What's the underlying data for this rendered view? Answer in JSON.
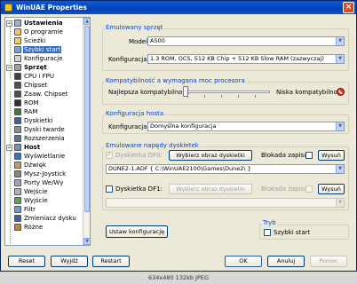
{
  "window": {
    "title": "WinUAE Properties",
    "close_label": "×"
  },
  "tree": {
    "group_ustawienia": "Ustawienia",
    "o_programie": "O programie",
    "sciezki": "Ścieżki",
    "szybki_start": "Szybki start",
    "konfiguracje": "Konfiguracje",
    "group_sprzet": "Sprzęt",
    "cpu": "CPU i FPU",
    "chipset": "Chipset",
    "zaaw_chipset": "Zaaw. Chipset",
    "rom": "ROM",
    "ram": "RAM",
    "dyskietki": "Dyskietki",
    "dyski_twarde": "Dyski twarde",
    "rozszerzenia": "Rozszerzenia",
    "group_host": "Host",
    "wyswietlanie": "Wyświetlanie",
    "dzwiek": "Dźwięk",
    "mysz": "Mysz-Joystick",
    "porty": "Porty We/Wy",
    "wejscie": "Wejście",
    "wyjscie": "Wyjście",
    "filtr": "Filtr",
    "zmieniacz": "Zmieniacz dysku",
    "rozne": "Różne",
    "expand_symbol": "−"
  },
  "emulated_hw": {
    "title": "Emulowany sprzęt",
    "model_label": "Model:",
    "model_value": "A500",
    "config_label": "Konfiguracja:",
    "config_value": "1.3 ROM, OCS, 512 KB Chip + 512 KB Slow RAM (zazwyczaj)"
  },
  "compat": {
    "title": "Kompatybilność a wymagana moc procesora",
    "best_label": "Najlepsza kompatybilność",
    "low_label": "Niska kompatybilność",
    "level": 0.0
  },
  "host_config": {
    "title": "Konfiguracja hosta",
    "config_label": "Konfiguracja:",
    "config_value": "Domyślna konfiguracja"
  },
  "floppy": {
    "title": "Emulowane napędy dyskietek",
    "df0_label": "Dyskietka DF0:",
    "df0_choose": "Wybierz obraz dyskietki",
    "df0_lock": "Blokada zapisu",
    "df0_eject": "Wysuń",
    "df0_path": "DUNE2-1.ADF { C:\\WinUAE2100\\Games\\Dune2\\ }",
    "df1_label": "Dyskietka DF1:",
    "df1_choose": "Wybierz obraz dyskietki",
    "df1_lock": "Blokada zapisu",
    "df1_eject": "Wysuń",
    "df1_path": ""
  },
  "set_config_button": "Ustaw konfigurację",
  "mode": {
    "title": "Tryb",
    "quick_start_label": "Szybki start"
  },
  "bottom_buttons": {
    "reset": "Reset",
    "exit": "Wyjdź",
    "restart": "Restart",
    "ok": "OK",
    "cancel": "Anuluj",
    "help": "Pomoc"
  },
  "caption": "634x480  132kb  JPEG",
  "icons": {
    "dropdown": "▼",
    "scroll_up": "▲",
    "scroll_down": "▼"
  }
}
